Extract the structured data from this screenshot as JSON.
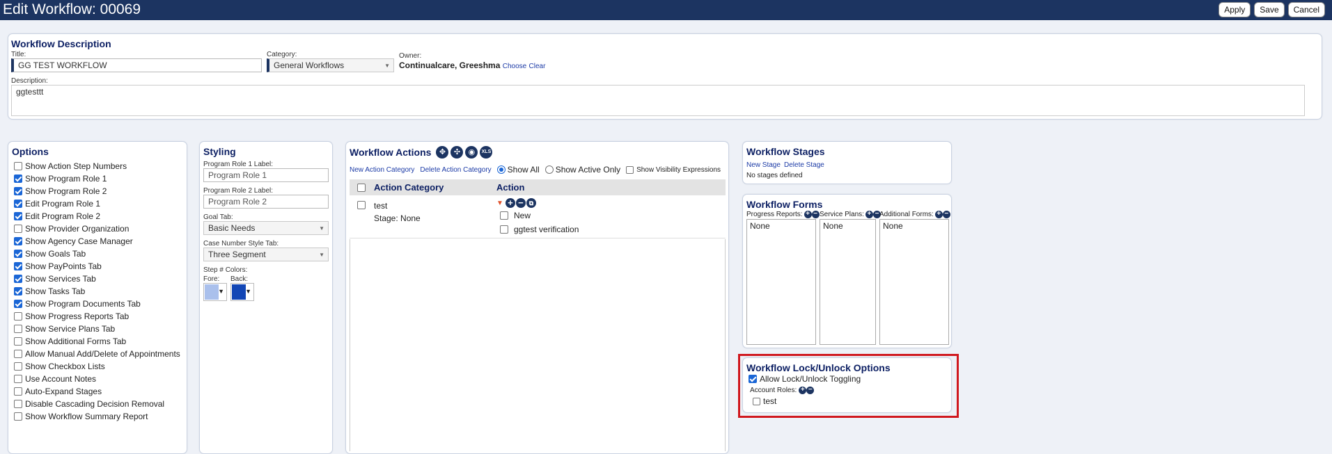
{
  "header": {
    "title": "Edit Workflow: 00069",
    "apply_label": "Apply",
    "save_label": "Save",
    "cancel_label": "Cancel"
  },
  "description_panel": {
    "heading": "Workflow Description",
    "title_label": "Title:",
    "title_value": "GG TEST WORKFLOW",
    "category_label": "Category:",
    "category_value": "General Workflows",
    "owner_label": "Owner:",
    "owner_value": "Continualcare, Greeshma",
    "choose_label": "Choose",
    "clear_label": "Clear",
    "description_label": "Description:",
    "description_value": "ggtesttt"
  },
  "options": {
    "heading": "Options",
    "items": [
      {
        "label": "Show Action Step Numbers",
        "checked": false
      },
      {
        "label": "Show Program Role 1",
        "checked": true
      },
      {
        "label": "Show Program Role 2",
        "checked": true
      },
      {
        "label": "Edit Program Role 1",
        "checked": true
      },
      {
        "label": "Edit Program Role 2",
        "checked": true
      },
      {
        "label": "Show Provider Organization",
        "checked": false
      },
      {
        "label": "Show Agency Case Manager",
        "checked": true
      },
      {
        "label": "Show Goals Tab",
        "checked": true
      },
      {
        "label": "Show PayPoints Tab",
        "checked": true
      },
      {
        "label": "Show Services Tab",
        "checked": true
      },
      {
        "label": "Show Tasks Tab",
        "checked": true
      },
      {
        "label": "Show Program Documents Tab",
        "checked": true
      },
      {
        "label": "Show Progress Reports Tab",
        "checked": false
      },
      {
        "label": "Show Service Plans Tab",
        "checked": false
      },
      {
        "label": "Show Additional Forms Tab",
        "checked": false
      },
      {
        "label": "Allow Manual Add/Delete of Appointments",
        "checked": false
      },
      {
        "label": "Show Checkbox Lists",
        "checked": false
      },
      {
        "label": "Use Account Notes",
        "checked": false
      },
      {
        "label": "Auto-Expand Stages",
        "checked": false
      },
      {
        "label": "Disable Cascading Decision Removal",
        "checked": false
      },
      {
        "label": "Show Workflow Summary Report",
        "checked": false
      }
    ]
  },
  "styling": {
    "heading": "Styling",
    "role1_label": "Program Role 1 Label:",
    "role1_value": "Program Role 1",
    "role2_label": "Program Role 2 Label:",
    "role2_value": "Program Role 2",
    "goal_tab_label": "Goal Tab:",
    "goal_tab_value": "Basic Needs",
    "case_number_label": "Case Number Style Tab:",
    "case_number_value": "Three Segment",
    "step_colors_label": "Step # Colors:",
    "fore_label": "Fore:",
    "back_label": "Back:",
    "fore_color": "#aac0ec",
    "back_color": "#1246b5"
  },
  "actions": {
    "heading": "Workflow Actions",
    "icons": [
      "expand-icon",
      "collapse-icon",
      "eye-icon",
      "xls-icon"
    ],
    "xls_text": "XLS",
    "new_category": "New Action Category",
    "delete_category": "Delete Action Category",
    "show_all": "Show All",
    "show_active": "Show Active Only",
    "show_visibility": "Show Visibility Expressions",
    "col_category": "Action Category",
    "col_action": "Action",
    "row_category": "test",
    "row_stage": "Stage: None",
    "row_actions": [
      "New",
      "ggtest verification"
    ]
  },
  "stages": {
    "heading": "Workflow Stages",
    "new_stage": "New Stage",
    "delete_stage": "Delete Stage",
    "empty": "No stages defined"
  },
  "forms": {
    "heading": "Workflow Forms",
    "progress_label": "Progress Reports:",
    "service_label": "Service Plans:",
    "additional_label": "Additional Forms:",
    "progress_value": "None",
    "service_value": "None",
    "additional_value": "None"
  },
  "lock": {
    "heading": "Workflow Lock/Unlock Options",
    "allow_label": "Allow Lock/Unlock Toggling",
    "allow_checked": true,
    "roles_label": "Account Roles:",
    "role_item": "test",
    "highlight_color": "#d0181e"
  }
}
